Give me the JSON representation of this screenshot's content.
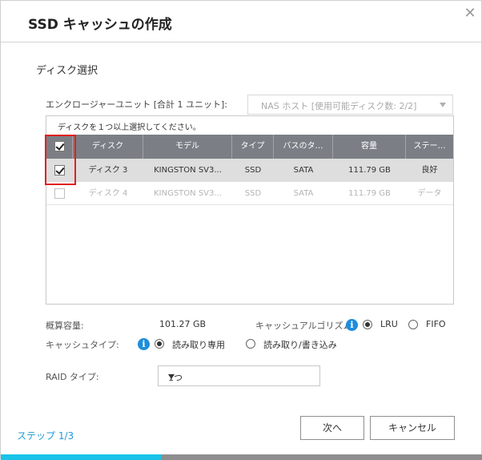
{
  "dialog": {
    "title": "SSD キャッシュの作成",
    "close_glyph": "✕"
  },
  "section": {
    "title": "ディスク選択"
  },
  "enclosure": {
    "label": "エンクロージャーユニット [合計 1 ユニット]:",
    "selected": "NAS ホスト [使用可能ディスク数: 2/2]"
  },
  "disk_table": {
    "hint": "ディスクを１つ以上選択してください。",
    "columns": [
      "ディスク",
      "モデル",
      "タイプ",
      "バスのタ…",
      "容量",
      "ステー…"
    ],
    "header_checkbox_checked": true,
    "rows": [
      {
        "checked": true,
        "disabled": false,
        "disk": "ディスク 3",
        "model": "KINGSTON SV3...",
        "type": "SSD",
        "bus": "SATA",
        "capacity": "111.79 GB",
        "status": "良好"
      },
      {
        "checked": false,
        "disabled": true,
        "disk": "ディスク 4",
        "model": "KINGSTON SV3...",
        "type": "SSD",
        "bus": "SATA",
        "capacity": "111.79 GB",
        "status": "データ"
      }
    ]
  },
  "summary": {
    "capacity_label": "概算容量:",
    "capacity_value": "101.27 GB",
    "algorithm_label": "キャッシュアルゴリズム:",
    "algorithm_options": [
      "LRU",
      "FIFO"
    ],
    "algorithm_selected": "LRU",
    "cache_type_label": "キャッシュタイプ:",
    "cache_type_options": [
      "読み取り専用",
      "読み取り/書き込み"
    ],
    "cache_type_selected": "読み取り専用",
    "raid_label": "RAID タイプ:",
    "raid_value": "1つ"
  },
  "footer": {
    "step": "ステップ 1/3",
    "next": "次へ",
    "cancel": "キャンセル",
    "progress_fraction": 0.333
  },
  "colors": {
    "accent": "#1f9ad6",
    "progress_fill": "#19c4e8",
    "table_header": "#7b7f85",
    "highlight_box": "#e0201e"
  },
  "icons": {
    "close": "close-icon",
    "info": "info-icon",
    "dropdown": "chevron-down-icon"
  }
}
